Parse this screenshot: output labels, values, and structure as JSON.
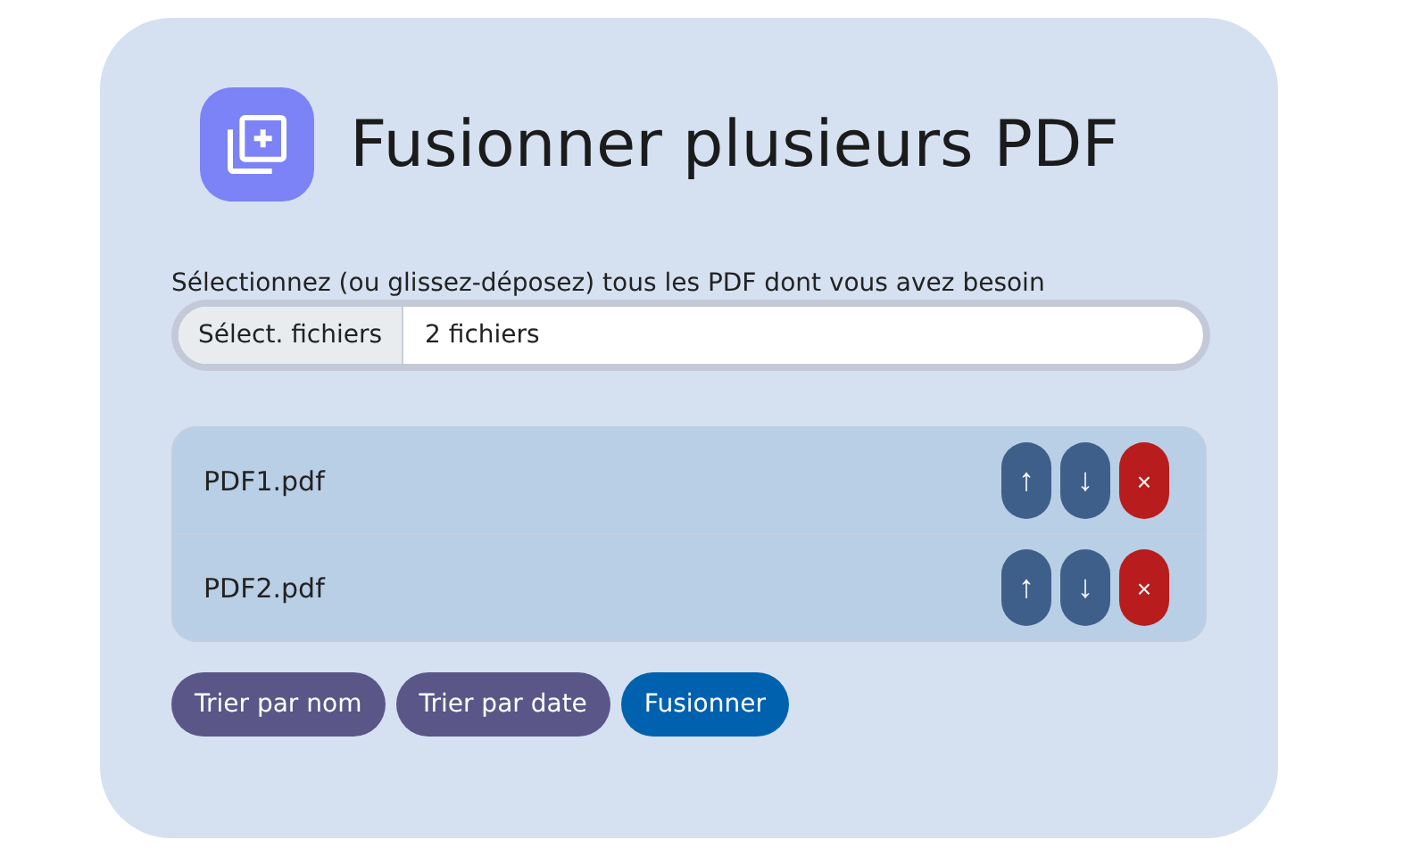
{
  "title": "Fusionner plusieurs PDF",
  "file_input": {
    "label": "Sélectionnez (ou glissez-déposez) tous les PDF dont vous avez besoin",
    "button": "Sélect. fichiers",
    "value": "2 fichiers"
  },
  "files": [
    {
      "name": "PDF1.pdf",
      "actions": [
        {
          "kind": "move",
          "label": "↑"
        },
        {
          "kind": "move",
          "label": "↓"
        },
        {
          "kind": "remove",
          "label": "×"
        }
      ]
    },
    {
      "name": "PDF2.pdf",
      "actions": [
        {
          "kind": "move",
          "label": "↑"
        },
        {
          "kind": "move",
          "label": "↓"
        },
        {
          "kind": "remove",
          "label": "×"
        }
      ]
    }
  ],
  "buttons": [
    {
      "kind": "secondary",
      "label": "Trier par nom"
    },
    {
      "kind": "secondary",
      "label": "Trier par date"
    },
    {
      "kind": "primary",
      "label": "Fusionner"
    }
  ]
}
